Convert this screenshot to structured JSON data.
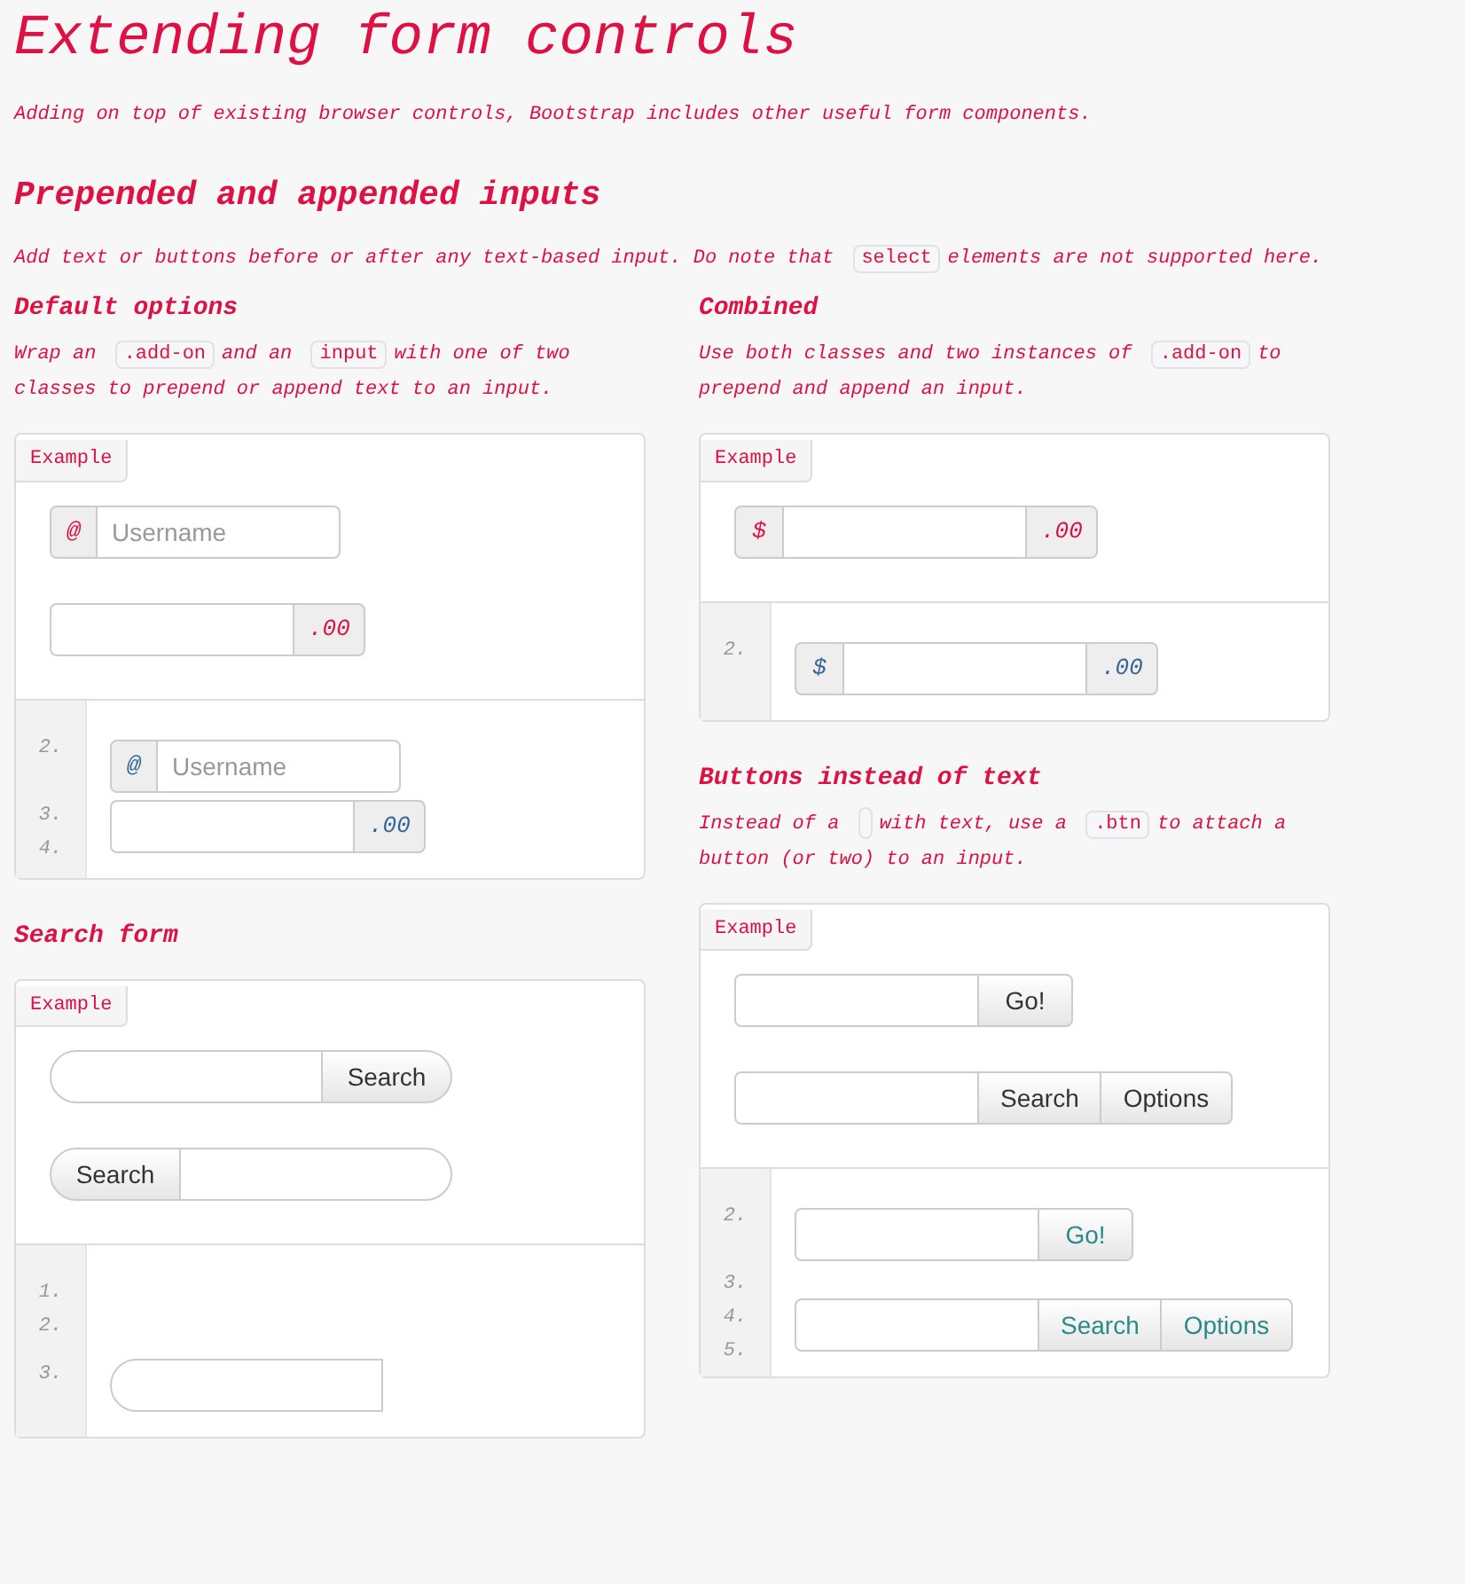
{
  "title": "Extending form controls",
  "lead": "Adding on top of existing browser controls, Bootstrap includes other useful form components.",
  "section": {
    "heading": "Prepended and appended inputs",
    "intro": [
      {
        "kind": "text",
        "text": "Add text or buttons before or after any text-based input. Do note that"
      },
      {
        "kind": "code",
        "text": "select"
      },
      {
        "kind": "text",
        "text": "elements are not supported here."
      }
    ]
  },
  "columns": [
    [
      {
        "heading": "Default options",
        "description": [
          {
            "kind": "text",
            "text": "Wrap an"
          },
          {
            "kind": "code",
            "text": ".add-on"
          },
          {
            "kind": "text",
            "text": "and an"
          },
          {
            "kind": "code",
            "text": "input"
          },
          {
            "kind": "text",
            "text": "with one of two classes to prepend or append text to an input."
          }
        ],
        "example": {
          "label": "Example",
          "controls": [
            {
              "kind": "prepend",
              "addon": "@",
              "placeholder": "Username"
            },
            {
              "kind": "append",
              "addon": ".00"
            }
          ]
        },
        "code": [
          {
            "numbers": [
              "2."
            ],
            "control": {
              "kind": "prepend",
              "addon": "@",
              "placeholder": "Username"
            }
          },
          {
            "numbers": [
              "3.",
              "4."
            ],
            "control": {
              "kind": "append",
              "addon": ".00"
            }
          }
        ]
      },
      {
        "heading": "Search form",
        "example": {
          "label": "Example",
          "controls": [
            {
              "kind": "search_append",
              "button": "Search"
            },
            {
              "kind": "search_prepend",
              "button": "Search"
            }
          ]
        },
        "code": [
          {
            "numbers": [
              "1.",
              "2."
            ]
          },
          {
            "numbers": [
              "3."
            ],
            "control": {
              "kind": "search_input"
            }
          }
        ]
      }
    ],
    [
      {
        "heading": "Combined",
        "description": [
          {
            "kind": "text",
            "text": "Use both classes and two instances of"
          },
          {
            "kind": "code",
            "text": ".add-on"
          },
          {
            "kind": "text",
            "text": "to prepend and append an input."
          }
        ],
        "example": {
          "label": "Example",
          "controls": [
            {
              "kind": "both",
              "prepend": "$",
              "append": ".00"
            }
          ]
        },
        "code": [
          {
            "numbers": [
              "2."
            ],
            "control": {
              "kind": "both",
              "prepend": "$",
              "append": ".00"
            }
          }
        ]
      },
      {
        "heading": "Buttons instead of text",
        "description": [
          {
            "kind": "text",
            "text": "Instead of a"
          },
          {
            "kind": "empty_code"
          },
          {
            "kind": "text",
            "text": "with text, use a"
          },
          {
            "kind": "code",
            "text": ".btn"
          },
          {
            "kind": "text",
            "text": "to attach a button (or two) to an input."
          }
        ],
        "example": {
          "label": "Example",
          "controls": [
            {
              "kind": "buttons",
              "buttons": [
                "Go!"
              ]
            },
            {
              "kind": "buttons",
              "buttons": [
                "Search",
                "Options"
              ]
            }
          ]
        },
        "code": [
          {
            "numbers": [
              "2."
            ],
            "control": {
              "kind": "buttons",
              "buttons": [
                "Go!"
              ]
            }
          },
          {
            "numbers": [
              "3.",
              "4.",
              "5."
            ],
            "control": {
              "kind": "buttons",
              "buttons": [
                "Search",
                "Options"
              ]
            }
          }
        ]
      }
    ]
  ]
}
